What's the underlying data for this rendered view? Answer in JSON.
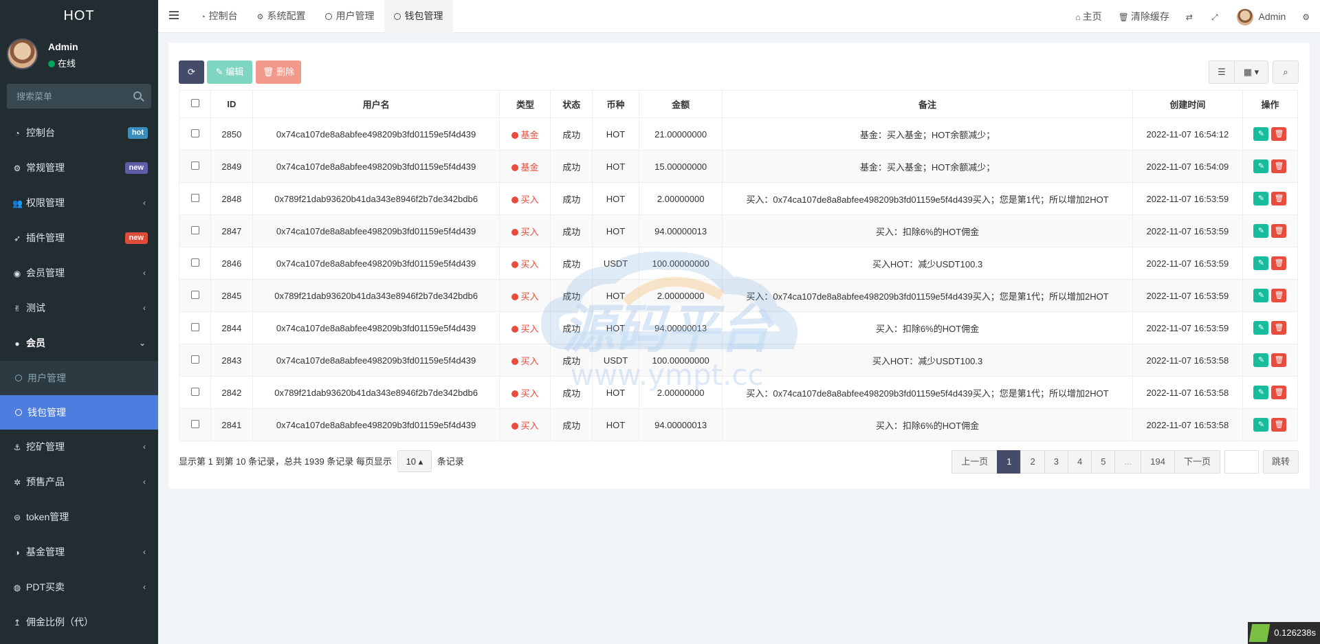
{
  "sidebar": {
    "logo": "HOT",
    "user": {
      "name": "Admin",
      "status": "在线"
    },
    "search_placeholder": "搜索菜单",
    "items": [
      {
        "label": "控制台",
        "icon": "dashboard-icon",
        "glyph": "◔",
        "badge": "hot",
        "badge_color": "#3c8dbc"
      },
      {
        "label": "常规管理",
        "icon": "cogs-icon",
        "glyph": "⚙",
        "badge": "new",
        "badge_color": "#605ca8"
      },
      {
        "label": "权限管理",
        "icon": "users-icon",
        "glyph": "👥",
        "arrow": "‹"
      },
      {
        "label": "插件管理",
        "icon": "rocket-icon",
        "glyph": "➶",
        "badge": "new",
        "badge_color": "#dd4b39"
      },
      {
        "label": "会员管理",
        "icon": "user-circle-icon",
        "glyph": "◉",
        "arrow": "‹"
      },
      {
        "label": "测试",
        "icon": "hand-icon",
        "glyph": "✌",
        "arrow": "‹"
      }
    ],
    "open_item": {
      "label": "会员",
      "icon": "user-icon",
      "glyph": "●",
      "arrow": "⌄"
    },
    "sub_items": [
      {
        "label": "用户管理"
      },
      {
        "label": "钱包管理"
      }
    ],
    "items_after": [
      {
        "label": "挖矿管理",
        "icon": "anchor-icon",
        "glyph": "⚓",
        "arrow": "‹"
      },
      {
        "label": "预售产品",
        "icon": "connect-icon",
        "glyph": "✲",
        "arrow": "‹"
      },
      {
        "label": "token管理",
        "icon": "token-icon",
        "glyph": "⊜"
      },
      {
        "label": "基金管理",
        "icon": "half-circle-icon",
        "glyph": "◑",
        "arrow": "‹"
      },
      {
        "label": "PDT买卖",
        "icon": "compass-icon",
        "glyph": "◍",
        "arrow": "‹"
      },
      {
        "label": "佣金比例（代）",
        "icon": "level-icon",
        "glyph": "↥"
      }
    ]
  },
  "header": {
    "tabs": [
      {
        "label": "控制台",
        "glyph": "◔",
        "icon": "dashboard-icon"
      },
      {
        "label": "系统配置",
        "glyph": "⚙",
        "icon": "cog-icon"
      },
      {
        "label": "用户管理",
        "icon": "circle-icon"
      },
      {
        "label": "钱包管理",
        "icon": "circle-icon"
      }
    ],
    "home": "主页",
    "clear_cache": "清除缓存",
    "admin": "Admin"
  },
  "toolbar": {
    "edit": "编辑",
    "delete": "删除"
  },
  "table": {
    "headers": [
      "ID",
      "用户名",
      "类型",
      "状态",
      "币种",
      "金额",
      "备注",
      "创建时间",
      "操作"
    ],
    "rows": [
      {
        "id": "2850",
        "user": "0x74ca107de8a8abfee498209b3fd01159e5f4d439",
        "type": "基金",
        "status": "成功",
        "coin": "HOT",
        "amount": "21.00000000",
        "note": "基金：买入基金；HOT余额减少；",
        "time": "2022-11-07 16:54:12"
      },
      {
        "id": "2849",
        "user": "0x74ca107de8a8abfee498209b3fd01159e5f4d439",
        "type": "基金",
        "status": "成功",
        "coin": "HOT",
        "amount": "15.00000000",
        "note": "基金：买入基金；HOT余额减少；",
        "time": "2022-11-07 16:54:09"
      },
      {
        "id": "2848",
        "user": "0x789f21dab93620b41da343e8946f2b7de342bdb6",
        "type": "买入",
        "status": "成功",
        "coin": "HOT",
        "amount": "2.00000000",
        "note": "买入：0x74ca107de8a8abfee498209b3fd01159e5f4d439买入；您是第1代；所以增加2HOT",
        "time": "2022-11-07 16:53:59"
      },
      {
        "id": "2847",
        "user": "0x74ca107de8a8abfee498209b3fd01159e5f4d439",
        "type": "买入",
        "status": "成功",
        "coin": "HOT",
        "amount": "94.00000013",
        "note": "买入：扣除6%的HOT佣金",
        "time": "2022-11-07 16:53:59"
      },
      {
        "id": "2846",
        "user": "0x74ca107de8a8abfee498209b3fd01159e5f4d439",
        "type": "买入",
        "status": "成功",
        "coin": "USDT",
        "amount": "100.00000000",
        "note": "买入HOT：减少USDT100.3",
        "time": "2022-11-07 16:53:59"
      },
      {
        "id": "2845",
        "user": "0x789f21dab93620b41da343e8946f2b7de342bdb6",
        "type": "买入",
        "status": "成功",
        "coin": "HOT",
        "amount": "2.00000000",
        "note": "买入：0x74ca107de8a8abfee498209b3fd01159e5f4d439买入；您是第1代；所以增加2HOT",
        "time": "2022-11-07 16:53:59"
      },
      {
        "id": "2844",
        "user": "0x74ca107de8a8abfee498209b3fd01159e5f4d439",
        "type": "买入",
        "status": "成功",
        "coin": "HOT",
        "amount": "94.00000013",
        "note": "买入：扣除6%的HOT佣金",
        "time": "2022-11-07 16:53:59"
      },
      {
        "id": "2843",
        "user": "0x74ca107de8a8abfee498209b3fd01159e5f4d439",
        "type": "买入",
        "status": "成功",
        "coin": "USDT",
        "amount": "100.00000000",
        "note": "买入HOT：减少USDT100.3",
        "time": "2022-11-07 16:53:58"
      },
      {
        "id": "2842",
        "user": "0x789f21dab93620b41da343e8946f2b7de342bdb6",
        "type": "买入",
        "status": "成功",
        "coin": "HOT",
        "amount": "2.00000000",
        "note": "买入：0x74ca107de8a8abfee498209b3fd01159e5f4d439买入；您是第1代；所以增加2HOT",
        "time": "2022-11-07 16:53:58"
      },
      {
        "id": "2841",
        "user": "0x74ca107de8a8abfee498209b3fd01159e5f4d439",
        "type": "买入",
        "status": "成功",
        "coin": "HOT",
        "amount": "94.00000013",
        "note": "买入：扣除6%的HOT佣金",
        "time": "2022-11-07 16:53:58"
      }
    ]
  },
  "pager": {
    "info_prefix": "显示第 1 到第 10 条记录，总共 1939 条记录 每页显示",
    "page_size": "10",
    "info_suffix": "条记录",
    "prev": "上一页",
    "pages": [
      "1",
      "2",
      "3",
      "4",
      "5",
      "...",
      "194"
    ],
    "active_page": "1",
    "next": "下一页",
    "jump": "跳转"
  },
  "watermark": {
    "text": "源码平台",
    "url": "www.ympt.cc"
  },
  "timer": "0.126238s",
  "colors": {
    "sidebar_bg": "#222d32",
    "active_sub": "#4e7de0",
    "primary_dark": "#444c69",
    "success": "#18bc9c",
    "danger": "#e74c3c"
  }
}
